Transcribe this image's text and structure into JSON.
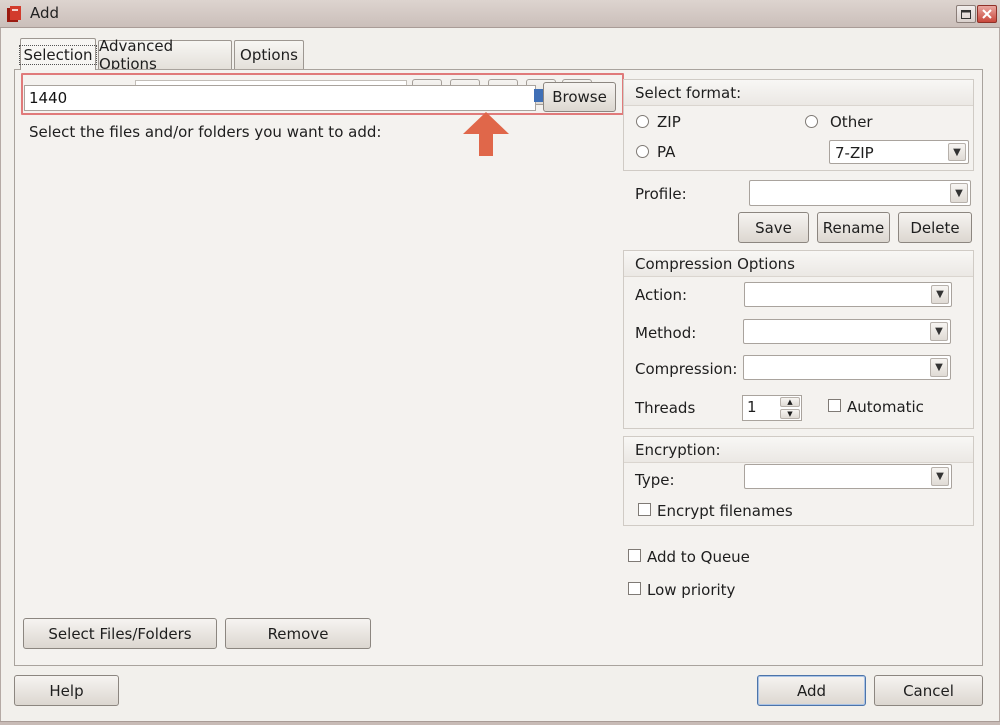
{
  "window": {
    "title": "Add",
    "minimize_icon": "maximize-icon",
    "close_icon": "close-icon"
  },
  "tabs": [
    {
      "label": "Selection",
      "active": true
    },
    {
      "label": "Advanced Options",
      "active": false
    },
    {
      "label": "Options",
      "active": false
    }
  ],
  "selection": {
    "path_value": "1440",
    "browse_label": "Browse",
    "instructions": "Select the files and/or folders you want to add:",
    "select_files_label": "Select Files/Folders",
    "remove_label": "Remove"
  },
  "format": {
    "title": "Select format:",
    "zip_label": "ZIP",
    "other_label": "Other",
    "pa_label": "PA",
    "other_value": "7-ZIP"
  },
  "profile": {
    "label": "Profile:",
    "value": "",
    "save_label": "Save",
    "rename_label": "Rename",
    "delete_label": "Delete"
  },
  "compression": {
    "title": "Compression Options",
    "action_label": "Action:",
    "method_label": "Method:",
    "compression_label": "Compression:",
    "threads_label": "Threads",
    "threads_value": "1",
    "automatic_label": "Automatic"
  },
  "encryption": {
    "title": "Encryption:",
    "type_label": "Type:",
    "encrypt_filenames_label": "Encrypt filenames"
  },
  "extras": {
    "queue_label": "Add to Queue",
    "low_priority_label": "Low priority"
  },
  "footer": {
    "help_label": "Help",
    "add_label": "Add",
    "cancel_label": "Cancel"
  },
  "colors": {
    "highlight_border": "#e07a7a",
    "arrow": "#e0674a"
  }
}
